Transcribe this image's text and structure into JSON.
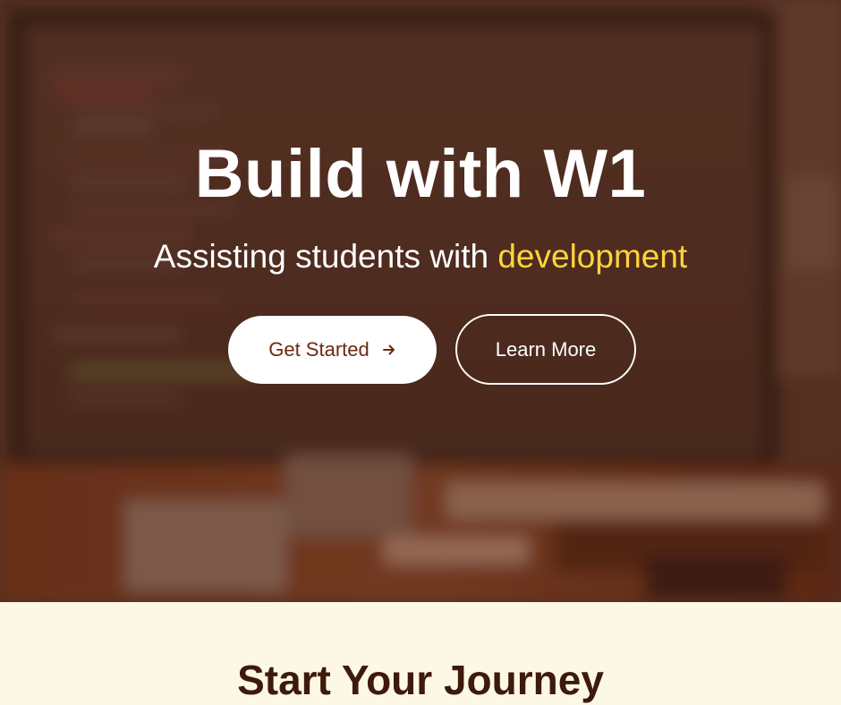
{
  "hero": {
    "title": "Build with W1",
    "subtitle_prefix": "Assisting students with ",
    "subtitle_accent": "development",
    "primary_button_label": "Get Started",
    "secondary_button_label": "Learn More",
    "accent_color": "#ffd43b",
    "overlay_color": "#4a2c22"
  },
  "section": {
    "title": "Start Your Journey",
    "background_color": "#fdf8e6"
  },
  "icons": {
    "primary_button_icon": "arrow-right-icon"
  }
}
